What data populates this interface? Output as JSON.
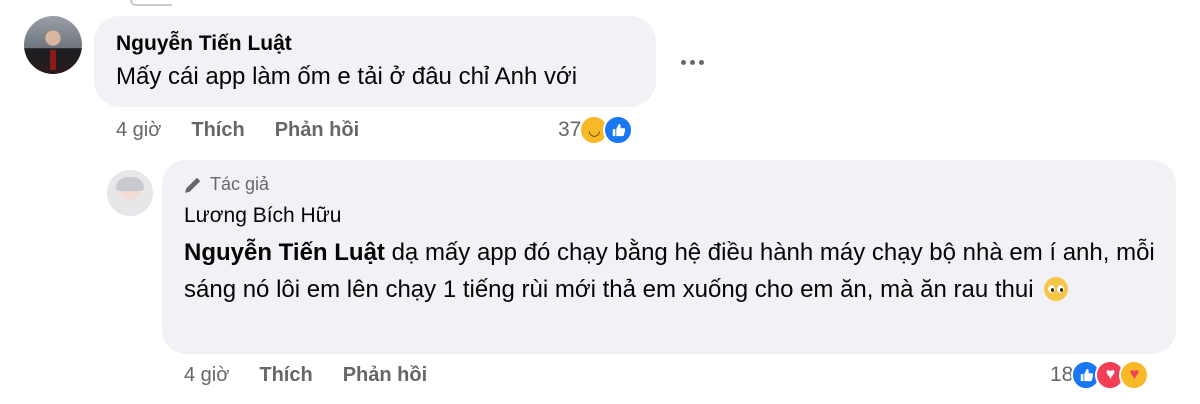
{
  "comments": [
    {
      "author": "Nguyễn Tiến Luật",
      "text": "Mấy cái app làm ốm e tải ở đâu chỉ Anh với",
      "time": "4 giờ",
      "like_label": "Thích",
      "reply_label": "Phản hồi",
      "reaction_count": "37",
      "reactions": [
        "haha-icon",
        "like-icon"
      ]
    }
  ],
  "reply": {
    "badge": "Tác giả",
    "author": "Lương Bích Hữu",
    "mention": "Nguyễn Tiến Luật",
    "text": "dạ mấy app đó chạy bằng hệ điều hành máy chạy bộ nhà em í anh, mỗi sáng nó lôi em lên chạy 1 tiếng rùi mới thả em xuống cho em ăn, mà ăn rau thui",
    "time": "4 giờ",
    "like_label": "Thích",
    "reply_label": "Phản hồi",
    "reaction_count": "18",
    "reactions": [
      "like-icon",
      "love-icon",
      "care-icon"
    ]
  },
  "colors": {
    "bubble": "#f0f2f5",
    "secondary_text": "#65676b",
    "like": "#1877f2",
    "love": "#f33e58"
  }
}
